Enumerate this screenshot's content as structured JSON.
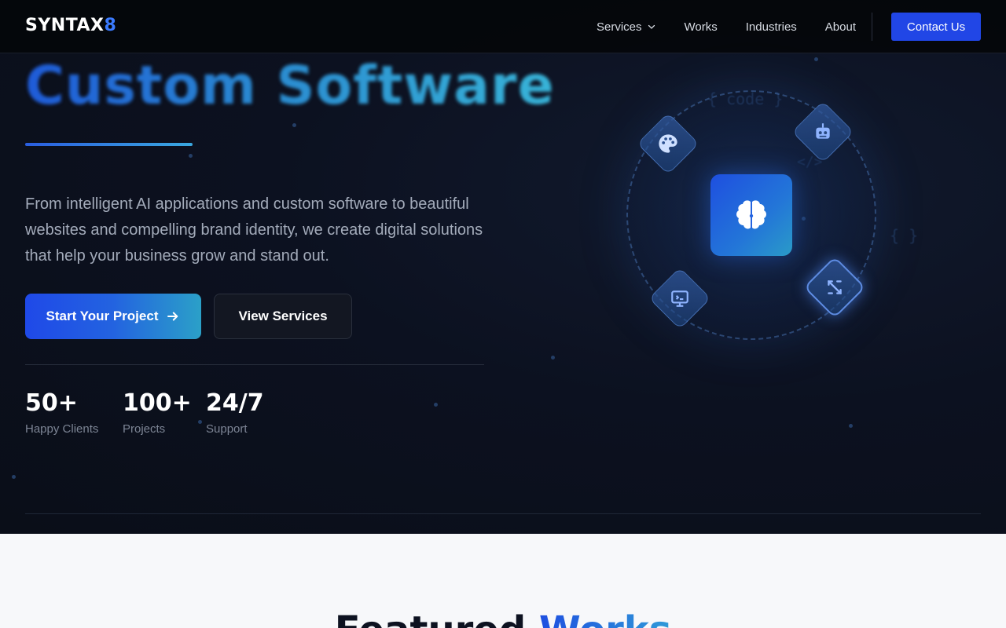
{
  "brand": {
    "name": "SYNTAX",
    "accent": "8",
    "accent_color": "#3b7bff"
  },
  "nav": {
    "items": [
      {
        "label": "Services",
        "has_dropdown": true
      },
      {
        "label": "Works"
      },
      {
        "label": "Industries"
      },
      {
        "label": "About"
      }
    ],
    "cta": "Contact Us"
  },
  "hero": {
    "title": "Custom Software",
    "description": "From intelligent AI applications and custom software to beautiful websites and compelling brand identity, we create digital solutions that help your business grow and stand out.",
    "primary_button": "Start Your Project",
    "secondary_button": "View Services",
    "stats": [
      {
        "value": "50+",
        "label": "Happy Clients"
      },
      {
        "value": "100+",
        "label": "Projects"
      },
      {
        "value": "24/7",
        "label": "Support"
      }
    ]
  },
  "illustration": {
    "center_icon": "brain-icon",
    "orbit_icons": [
      "palette-icon",
      "robot-icon",
      "design-monitor-icon",
      "code-tool-icon"
    ],
    "code_glyphs": [
      "{ code }",
      "</>",
      "{ }"
    ]
  },
  "featured": {
    "title_main": "Featured",
    "title_highlight": "Works"
  },
  "colors": {
    "primary": "#2146e6",
    "hero_bg": "#0b0f19",
    "section_bg": "#f7f8fa",
    "gradient_end": "#2ba0c8"
  }
}
